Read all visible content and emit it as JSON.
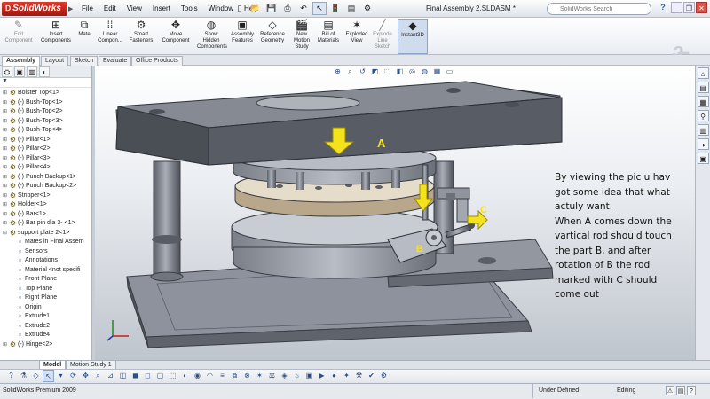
{
  "app": {
    "logo": "SolidWorks",
    "document_title": "Final Assembly 2.SLDASM *"
  },
  "menu": [
    "File",
    "Edit",
    "View",
    "Insert",
    "Tools",
    "Window",
    "Help"
  ],
  "search": {
    "placeholder": "SolidWorks Search"
  },
  "command_manager": [
    {
      "label": "Edit\nComponent",
      "icon": "edit-component-icon",
      "dim": true
    },
    {
      "label": "Insert\nComponents",
      "icon": "insert-components-icon",
      "dim": false
    },
    {
      "label": "Mate",
      "icon": "mate-icon",
      "dim": false
    },
    {
      "label": "Linear\nCompon...",
      "icon": "linear-pattern-icon",
      "dim": false
    },
    {
      "label": "Smart\nFasteners",
      "icon": "smart-fasteners-icon",
      "dim": false
    },
    {
      "label": "Move\nComponent",
      "icon": "move-component-icon",
      "dim": false
    },
    {
      "label": "Show\nHidden\nComponents",
      "icon": "show-hidden-icon",
      "dim": false
    },
    {
      "label": "Assembly\nFeatures",
      "icon": "assembly-features-icon",
      "dim": false
    },
    {
      "label": "Reference\nGeometry",
      "icon": "reference-geometry-icon",
      "dim": false
    },
    {
      "label": "New\nMotion\nStudy",
      "icon": "motion-study-icon",
      "dim": false
    },
    {
      "label": "Bill of\nMaterials",
      "icon": "bom-icon",
      "dim": false
    },
    {
      "label": "Exploded\nView",
      "icon": "exploded-view-icon",
      "dim": false
    },
    {
      "label": "Explode\nLine\nSketch",
      "icon": "explode-line-icon",
      "dim": true
    },
    {
      "label": "Instant3D",
      "icon": "instant3d-icon",
      "dim": false,
      "active": true
    }
  ],
  "command_tabs": [
    "Assembly",
    "Layout",
    "Sketch",
    "Evaluate",
    "Office Products"
  ],
  "feature_tree": [
    {
      "label": "Bolster Top<1>",
      "level": 0
    },
    {
      "label": "(-) Bush-Top<1>",
      "level": 0
    },
    {
      "label": "(-) Bush-Top<2>",
      "level": 0
    },
    {
      "label": "(-) Bush-Top<3>",
      "level": 0
    },
    {
      "label": "(-) Bush-Top<4>",
      "level": 0
    },
    {
      "label": "(-) Pillar<1>",
      "level": 0
    },
    {
      "label": "(-) Pillar<2>",
      "level": 0
    },
    {
      "label": "(-) Pillar<3>",
      "level": 0
    },
    {
      "label": "(-) Pillar<4>",
      "level": 0
    },
    {
      "label": "(-) Punch Backup<1>",
      "level": 0
    },
    {
      "label": "(-) Punch Backup<2>",
      "level": 0
    },
    {
      "label": "Stripper<1>",
      "level": 0
    },
    {
      "label": "Holder<1>",
      "level": 0
    },
    {
      "label": "(-) Bar<1>",
      "level": 0
    },
    {
      "label": "(-) Bar pin dia 3- <1>",
      "level": 0
    },
    {
      "label": "support plate 2<1>",
      "level": 0,
      "expanded": true
    },
    {
      "label": "Mates in Final Assem",
      "level": 1
    },
    {
      "label": "Sensors",
      "level": 1
    },
    {
      "label": "Annotations",
      "level": 1
    },
    {
      "label": "Material <not specifi",
      "level": 1
    },
    {
      "label": "Front Plane",
      "level": 1
    },
    {
      "label": "Top Plane",
      "level": 1
    },
    {
      "label": "Right Plane",
      "level": 1
    },
    {
      "label": "Origin",
      "level": 1
    },
    {
      "label": "Extrude1",
      "level": 1
    },
    {
      "label": "Extrude2",
      "level": 1
    },
    {
      "label": "Extrude4",
      "level": 1
    },
    {
      "label": "(-) Hinge<2>",
      "level": 0
    }
  ],
  "viewport": {
    "labels": {
      "a": "A",
      "b": "B",
      "c": "C"
    },
    "annotation_lines": [
      "By viewing the pic u hav",
      "got some idea that what",
      "actuly want.",
      "When A comes down the",
      "vartical rod should touch",
      "the part B, and after",
      "rotation of B the rod",
      "marked with C should",
      "come out"
    ],
    "colors": {
      "arrow": "#f4e21c",
      "label": "#f4e21c",
      "steel": "#6e7480"
    }
  },
  "bottom_tabs": [
    "Model",
    "Motion Study 1"
  ],
  "status": {
    "product": "SolidWorks Premium 2009",
    "state": "Under Defined",
    "mode": "Editing Assembly"
  }
}
